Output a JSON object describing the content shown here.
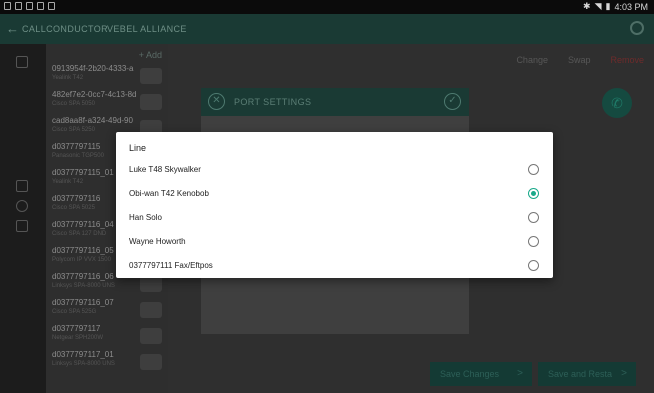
{
  "status_bar": {
    "time": "4:03 PM"
  },
  "app_bar": {
    "back_icon": "back-arrow-icon",
    "tabs": [
      "CALLCONDUCTOR",
      "VEBEL ALLIANCE"
    ],
    "sync_icon": "sync-icon"
  },
  "device_list": {
    "add_label": "+ Add",
    "items": [
      {
        "name": "0913954f-2b20-4333-a",
        "model": "Yealink T42"
      },
      {
        "name": "482ef7e2-0cc7-4c13-8d",
        "model": "Cisco SPA 5050"
      },
      {
        "name": "cad8aa8f-a324-49d-90",
        "model": "Cisco SPA 5250"
      },
      {
        "name": "d0377797115",
        "model": "Panasonic TGP500"
      },
      {
        "name": "d0377797115_01",
        "model": "Yealink T42"
      },
      {
        "name": "d0377797116",
        "model": "Cisco SPA 5025"
      },
      {
        "name": "d0377797116_04",
        "model": "Cisco SPA 127 DND"
      },
      {
        "name": "d0377797116_05",
        "model": "Polycom IP VVX 1500"
      },
      {
        "name": "d0377797116_06",
        "model": "Linksys SPA-8000 UNS"
      },
      {
        "name": "d0377797116_07",
        "model": "Cisco SPA 525G"
      },
      {
        "name": "d0377797117",
        "model": "Netgear SPH200W"
      },
      {
        "name": "d0377797117_01",
        "model": "Linksys SPA-8000 UNS"
      }
    ]
  },
  "toolbar": {
    "change": "Change",
    "swap": "Swap",
    "remove": "Remove"
  },
  "port_settings": {
    "title": "PORT SETTINGS"
  },
  "bottom_buttons": {
    "save_changes": "Save Changes",
    "save_restart": "Save and Restart",
    "arrow": ">"
  },
  "line_dialog": {
    "title": "Line",
    "options": [
      {
        "label": "Luke T48 Skywalker",
        "checked": false
      },
      {
        "label": "Obi-wan T42 Kenobob",
        "checked": true
      },
      {
        "label": "Han Solo",
        "checked": false
      },
      {
        "label": "Wayne Howorth",
        "checked": false
      },
      {
        "label": "0377797111 Fax/Eftpos",
        "checked": false
      }
    ]
  },
  "colors": {
    "accent": "#19a98a",
    "header_dark": "#1a3a34",
    "dialog_bg": "#ffffff"
  }
}
